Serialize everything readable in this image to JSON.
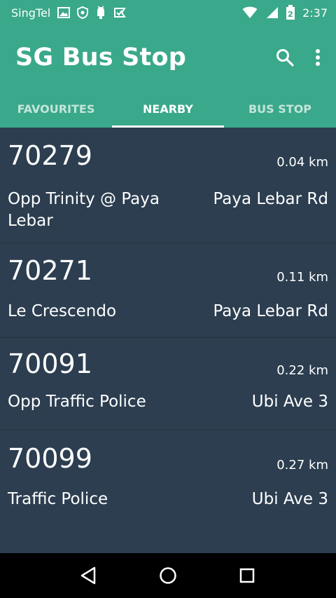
{
  "status_bar": {
    "carrier": "SingTel",
    "time": "2:37",
    "battery_level": "2",
    "icons": [
      "image-icon",
      "shield-icon",
      "android-icon",
      "check-flag-icon",
      "wifi-icon",
      "signal-icon",
      "battery-icon"
    ]
  },
  "app_bar": {
    "title": "SG Bus Stop",
    "actions": [
      "search-icon",
      "more-vert-icon"
    ]
  },
  "tabs": [
    {
      "label": "FAVOURITES",
      "active": false
    },
    {
      "label": "NEARBY",
      "active": true
    },
    {
      "label": "BUS STOP",
      "active": false
    }
  ],
  "stops": [
    {
      "code": "70279",
      "distance": "0.04 km",
      "description": "Opp Trinity @ Paya Lebar",
      "road": "Paya Lebar Rd"
    },
    {
      "code": "70271",
      "distance": "0.11 km",
      "description": "Le Crescendo",
      "road": "Paya Lebar Rd"
    },
    {
      "code": "70091",
      "distance": "0.22 km",
      "description": "Opp Traffic Police",
      "road": "Ubi Ave 3"
    },
    {
      "code": "70099",
      "distance": "0.27 km",
      "description": "Traffic Police",
      "road": "Ubi Ave 3"
    }
  ],
  "nav_bar": [
    "back-icon",
    "home-icon",
    "recents-icon"
  ],
  "colors": {
    "primary": "#3aa88a",
    "background": "#2c3e50",
    "divider": "#25333f",
    "nav": "#000000"
  }
}
